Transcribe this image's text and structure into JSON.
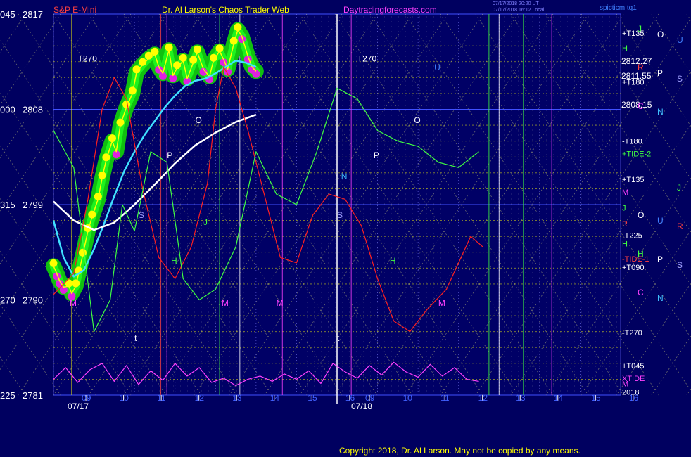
{
  "header": {
    "symbol": "S&P E-Mini",
    "title": "Dr. Al Larson's Chaos Trader Web",
    "site": "Daytradingforecasts.com",
    "stamp1": "07/17/2018 20:20 UT",
    "stamp2": "07/17/2018 16:12 Local",
    "brand": "spicticm.tq1"
  },
  "copyright": "Copyright 2018, Dr. Al Larson. May not be copied by any means.",
  "chart_data": {
    "type": "line",
    "ylim": [
      2781,
      2817
    ],
    "y_tick_labels": [
      {
        "left": "045",
        "value": 2817
      },
      {
        "left": "000",
        "value": 2808
      },
      {
        "left": "315",
        "value": 2799
      },
      {
        "left": "270",
        "value": 2790
      },
      {
        "left": "225",
        "value": 2781
      }
    ],
    "x_ticks_day1": [
      "09",
      "10",
      "11",
      "12",
      "13",
      "14",
      "15",
      "16"
    ],
    "x_ticks_day2": [
      "09",
      "10",
      "11",
      "12",
      "13",
      "14",
      "15",
      "16"
    ],
    "date_labels": [
      "07/17",
      "07/18"
    ],
    "price_labels": [
      "2812.27",
      "2811.55",
      "2808.15"
    ],
    "right_labels": [
      {
        "text": "+T135",
        "y": 2815.2,
        "color": "#ffffff"
      },
      {
        "text": "H",
        "y": 2813.8,
        "color": "#40ff40"
      },
      {
        "text": "+T180",
        "y": 2810.6,
        "color": "#ffffff"
      },
      {
        "text": "-T180",
        "y": 2805.0,
        "color": "#ffffff"
      },
      {
        "text": "+TIDE-2",
        "y": 2803.8,
        "color": "#40ff40"
      },
      {
        "text": "+T135",
        "y": 2801.4,
        "color": "#ffffff"
      },
      {
        "text": "M",
        "y": 2800.2,
        "color": "#ff40ff"
      },
      {
        "text": "J",
        "y": 2798.7,
        "color": "#40ff40"
      },
      {
        "text": "R",
        "y": 2797.2,
        "color": "#ff4040"
      },
      {
        "text": "-T225",
        "y": 2796.1,
        "color": "#ffffff"
      },
      {
        "text": "H",
        "y": 2795.3,
        "color": "#40ff40"
      },
      {
        "text": "-TIDE-1",
        "y": 2793.9,
        "color": "#ff4040"
      },
      {
        "text": "+T090",
        "y": 2793.1,
        "color": "#ffffff"
      },
      {
        "text": "-T270",
        "y": 2786.9,
        "color": "#ffffff"
      },
      {
        "text": "+T045",
        "y": 2783.8,
        "color": "#ffffff"
      },
      {
        "text": "XTIDE",
        "y": 2782.6,
        "color": "#ff40ff"
      },
      {
        "text": "M",
        "y": 2782.1,
        "color": "#ff40ff"
      },
      {
        "text": "2018",
        "y": 2781.3,
        "color": "#ffffff"
      }
    ],
    "planet_letters": [
      {
        "text": "J",
        "color": "#40ff40"
      },
      {
        "text": "O",
        "color": "#ffffff"
      },
      {
        "text": "U",
        "color": "#4080ff"
      },
      {
        "text": "R",
        "color": "#ff4040"
      },
      {
        "text": "P",
        "color": "#ffffff"
      },
      {
        "text": "S",
        "color": "#a0a0ff"
      },
      {
        "text": "C",
        "color": "#ff40ff"
      },
      {
        "text": "N",
        "color": "#40c0ff"
      },
      {
        "text": "J",
        "color": "#40ff40"
      },
      {
        "text": "O",
        "color": "#ffffff"
      },
      {
        "text": "U",
        "color": "#4080ff"
      },
      {
        "text": "R",
        "color": "#ff4040"
      },
      {
        "text": "H",
        "color": "#40ff40"
      },
      {
        "text": "P",
        "color": "#ffffff"
      },
      {
        "text": "S",
        "color": "#a0a0ff"
      },
      {
        "text": "C",
        "color": "#ff40ff"
      },
      {
        "text": "N",
        "color": "#40c0ff"
      }
    ],
    "in_chart_labels": [
      {
        "text": "T270",
        "color": "#ffffff"
      },
      {
        "text": "T270",
        "color": "#ffffff"
      },
      {
        "text": "O",
        "color": "#ffffff"
      },
      {
        "text": "P",
        "color": "#ffffff"
      },
      {
        "text": "S",
        "color": "#a0a0ff"
      },
      {
        "text": "J",
        "color": "#40ff40"
      },
      {
        "text": "H",
        "color": "#40ff40"
      },
      {
        "text": "M",
        "color": "#ff40ff"
      },
      {
        "text": "M",
        "color": "#ff40ff"
      },
      {
        "text": "M",
        "color": "#ff40ff"
      },
      {
        "text": "O",
        "color": "#ffffff"
      },
      {
        "text": "P",
        "color": "#ffffff"
      },
      {
        "text": "S",
        "color": "#a0a0ff"
      },
      {
        "text": "N",
        "color": "#40c0ff"
      },
      {
        "text": "H",
        "color": "#40ff40"
      },
      {
        "text": "M",
        "color": "#ff40ff"
      },
      {
        "text": "U",
        "color": "#4080ff"
      },
      {
        "text": "t",
        "color": "#ffffff"
      },
      {
        "text": "t",
        "color": "#ffffff"
      }
    ],
    "series": [
      {
        "name": "price",
        "color": "#ffff00",
        "x": [
          0,
          0.08,
          0.15,
          0.25,
          0.38,
          0.45,
          0.55,
          0.62,
          0.72,
          0.85,
          0.95,
          1.1,
          1.2,
          1.3,
          1.45,
          1.55,
          1.65,
          1.8,
          1.95,
          2.05,
          2.2,
          2.35,
          2.5,
          2.6,
          2.7,
          2.85,
          2.95,
          3.05,
          3.2,
          3.3,
          3.45,
          3.55,
          3.7,
          3.85,
          3.95,
          4.1,
          4.2,
          4.3,
          4.45,
          4.55,
          4.65,
          4.8,
          4.9,
          5.0
        ],
        "y": [
          2793.2,
          2792.5,
          2791.8,
          2791.2,
          2791.3,
          2790.6,
          2791.3,
          2792.5,
          2794.2,
          2796.5,
          2797.8,
          2799.5,
          2801.5,
          2803.2,
          2805.0,
          2804.0,
          2806.5,
          2808.2,
          2809.5,
          2811.5,
          2812.2,
          2812.8,
          2813.2,
          2812.0,
          2811.4,
          2813.6,
          2811.2,
          2811.9,
          2812.6,
          2810.9,
          2812.4,
          2813.4,
          2811.8,
          2811.1,
          2812.6,
          2813.5,
          2812.7,
          2811.8,
          2814.2,
          2815.5,
          2814.9,
          2813.0,
          2812.0,
          2811.6
        ]
      },
      {
        "name": "fast-average",
        "color": "#40e0ff",
        "x": [
          0,
          0.25,
          0.5,
          0.75,
          1.0,
          1.25,
          1.5,
          1.75,
          2.0,
          2.25,
          2.5,
          2.75,
          3.0,
          3.25,
          3.5,
          3.75,
          4.0,
          4.25,
          4.5,
          4.75,
          5.0
        ],
        "y": [
          2797.5,
          2794.0,
          2792.2,
          2792.8,
          2794.8,
          2797.2,
          2799.8,
          2802.2,
          2804.0,
          2805.6,
          2806.9,
          2808.2,
          2809.3,
          2810.2,
          2810.7,
          2810.9,
          2811.4,
          2812.0,
          2812.6,
          2812.4,
          2812.0
        ]
      },
      {
        "name": "slow-average",
        "color": "#ffffff",
        "x": [
          0,
          0.5,
          1.0,
          1.5,
          2.0,
          2.5,
          3.0,
          3.5,
          4.0,
          4.5,
          5.0
        ],
        "y": [
          2799.3,
          2797.5,
          2796.6,
          2797.3,
          2799.0,
          2800.9,
          2802.9,
          2804.6,
          2805.8,
          2806.8,
          2807.5
        ]
      },
      {
        "name": "red-wave",
        "color": "#ff2020",
        "x": [
          0,
          0.5,
          0.85,
          1.2,
          1.5,
          1.8,
          2.2,
          2.6,
          3.0,
          3.4,
          3.8,
          4.0,
          4.2,
          4.5,
          4.8,
          5.2,
          5.6,
          6.0,
          6.4,
          6.8,
          7.2,
          7.6,
          8.0,
          8.4,
          8.8,
          9.2,
          9.7,
          10.3,
          10.6
        ],
        "y": [
          2790.5,
          2792.5,
          2799.5,
          2808.0,
          2811.0,
          2809.0,
          2800.5,
          2794.0,
          2792.0,
          2795.0,
          2801.0,
          2808.0,
          2812.0,
          2810.0,
          2806.0,
          2800.0,
          2794.0,
          2793.5,
          2798.0,
          2800.0,
          2799.5,
          2797.0,
          2792.0,
          2788.0,
          2787.0,
          2789.0,
          2791.0,
          2796.0,
          2795.0
        ]
      },
      {
        "name": "green-wave",
        "color": "#40ff40",
        "x": [
          0,
          0.5,
          1.0,
          1.4,
          1.7,
          2.0,
          2.4,
          2.8,
          3.2,
          3.6,
          4.0,
          4.5,
          5.0,
          5.5,
          6.0,
          6.5,
          7.0,
          7.5,
          8.0,
          8.5,
          9.0,
          9.5,
          10.0,
          10.5
        ],
        "y": [
          2806.0,
          2802.5,
          2787.0,
          2790.0,
          2799.0,
          2796.5,
          2804.0,
          2803.0,
          2792.0,
          2790.0,
          2791.0,
          2795.0,
          2804.0,
          2800.0,
          2799.0,
          2804.0,
          2810.0,
          2809.0,
          2806.0,
          2805.0,
          2804.5,
          2803.0,
          2802.5,
          2804.0
        ]
      },
      {
        "name": "xtide",
        "color": "#ff40ff",
        "x": [
          0,
          0.3,
          0.6,
          0.9,
          1.2,
          1.5,
          1.8,
          2.1,
          2.4,
          2.7,
          3.0,
          3.3,
          3.6,
          3.9,
          4.2,
          4.5,
          4.8,
          5.1,
          5.4,
          5.7,
          6.0,
          6.3,
          6.6,
          6.9,
          7.2,
          7.5,
          7.8,
          8.1,
          8.4,
          8.7,
          9.0,
          9.3,
          9.6,
          9.9,
          10.2,
          10.5
        ],
        "y": [
          2782.5,
          2783.6,
          2782.2,
          2783.4,
          2784.0,
          2782.3,
          2783.8,
          2782.0,
          2783.3,
          2782.4,
          2784.0,
          2782.8,
          2783.6,
          2782.2,
          2782.6,
          2781.9,
          2782.5,
          2782.8,
          2782.3,
          2783.0,
          2782.5,
          2783.3,
          2782.1,
          2784.0,
          2783.2,
          2782.6,
          2783.8,
          2782.9,
          2784.1,
          2783.2,
          2782.7,
          2783.9,
          2782.8,
          2783.6,
          2782.5,
          2782.3
        ]
      }
    ]
  }
}
